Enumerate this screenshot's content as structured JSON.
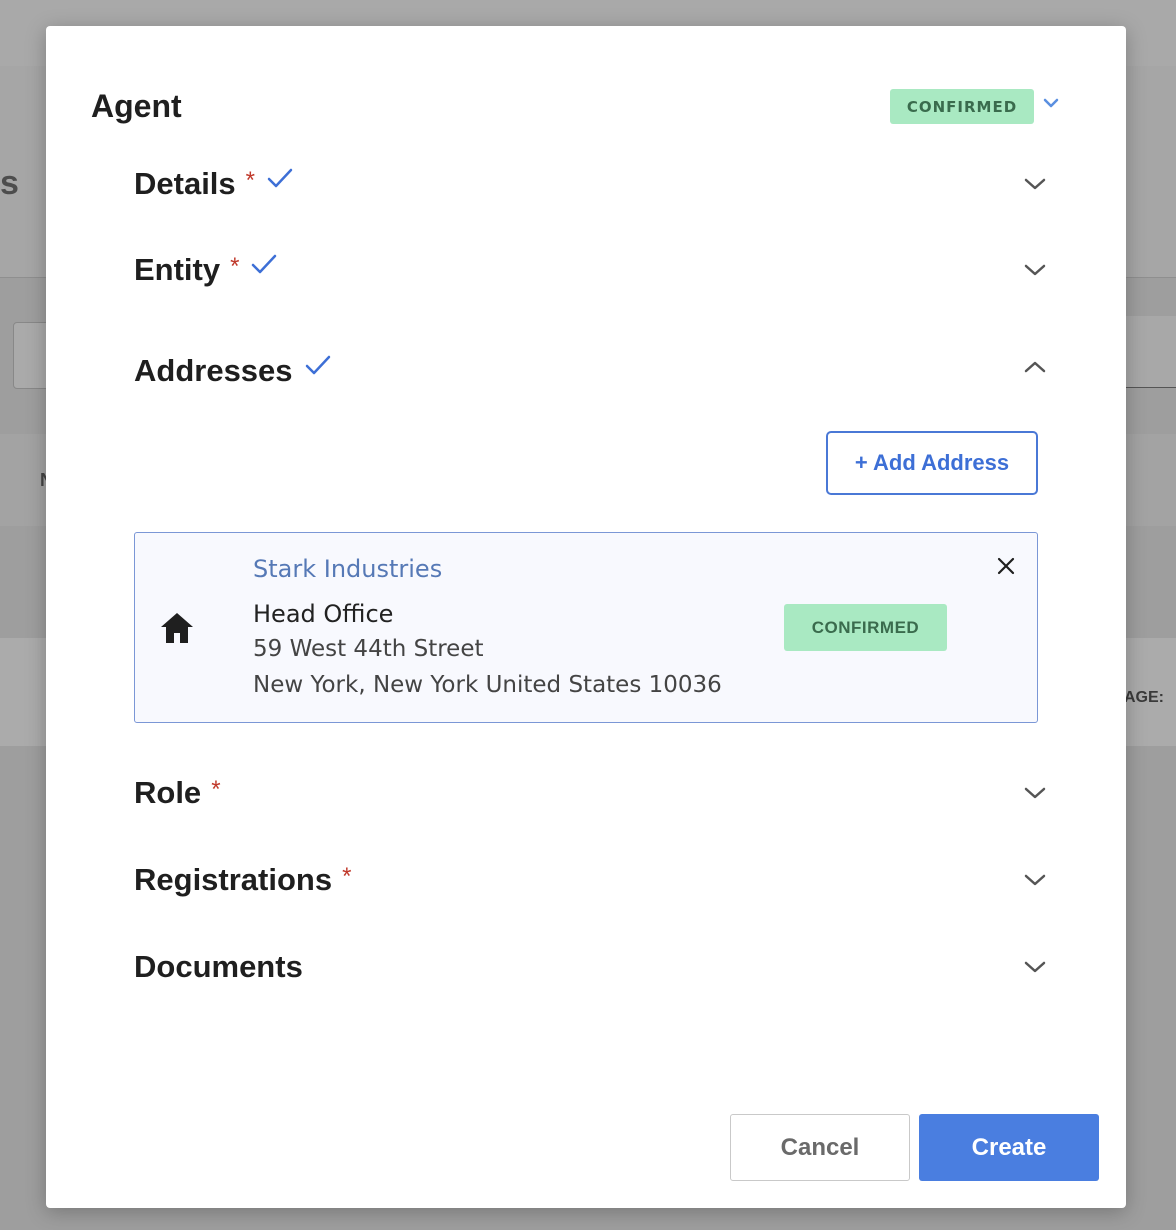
{
  "background": {
    "fragment_heading": "s",
    "fragment_column": "N",
    "fragment_label": "AGE:"
  },
  "modal": {
    "title": "Agent",
    "status": "CONFIRMED",
    "sections": {
      "details": {
        "label": "Details",
        "required": "*",
        "completed": true,
        "expanded": false
      },
      "entity": {
        "label": "Entity",
        "required": "*",
        "completed": true,
        "expanded": false
      },
      "addresses": {
        "label": "Addresses",
        "completed": true,
        "expanded": true
      },
      "role": {
        "label": "Role",
        "required": "*",
        "expanded": false
      },
      "registrations": {
        "label": "Registrations",
        "required": "*",
        "expanded": false
      },
      "documents": {
        "label": "Documents",
        "expanded": false
      }
    },
    "add_address_label": "+ Add Address",
    "address_card": {
      "company": "Stark Industries",
      "name": "Head Office",
      "line1": "59 West 44th Street",
      "line2": "New York, New York United States 10036",
      "status": "CONFIRMED",
      "icon": "home-icon"
    },
    "footer": {
      "cancel_label": "Cancel",
      "create_label": "Create"
    }
  },
  "colors": {
    "accent": "#4a7ee0",
    "confirmed_bg": "#a9e9c2",
    "confirmed_text": "#3a6b4d",
    "required": "#c0392b",
    "check": "#3d6fd6"
  }
}
